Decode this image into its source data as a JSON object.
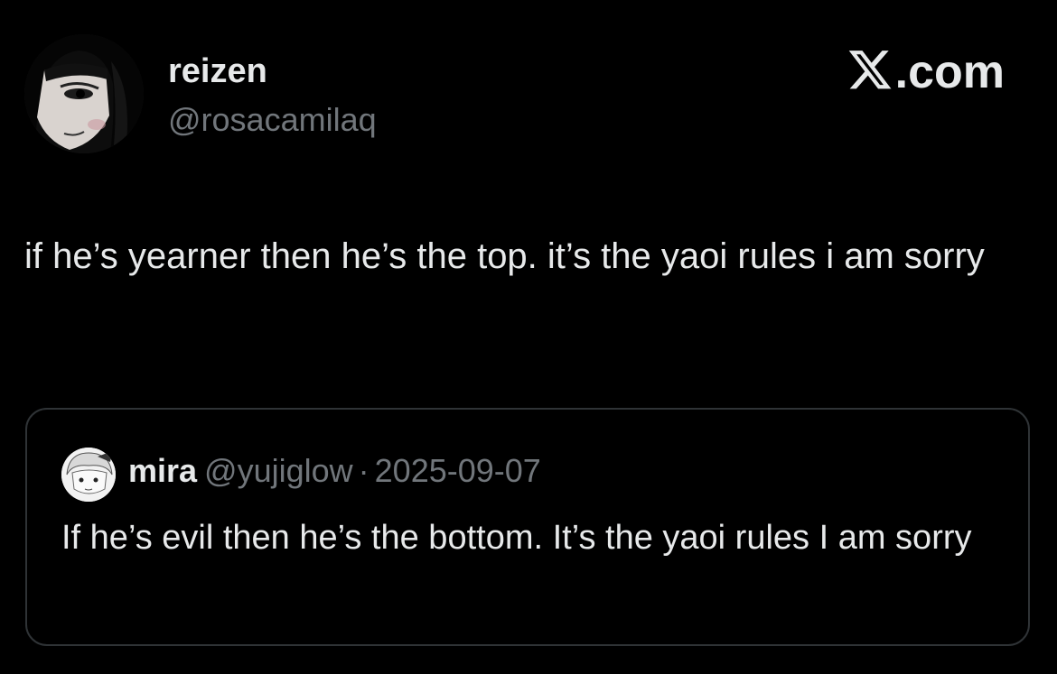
{
  "post": {
    "author": {
      "display_name": "reizen",
      "handle": "@rosacamilaq",
      "avatar": "manga-portrait-avatar"
    },
    "brand": {
      "label": ".com",
      "icon": "x-logo-icon"
    },
    "text": "if he’s yearner then he’s the top. it’s the yaoi rules i am sorry",
    "quoted": {
      "display_name": "mira",
      "handle": "@yujiglow",
      "separator": "·",
      "date": "2025-09-07",
      "text": "If he’s evil then he’s the bottom. It’s the yaoi rules I am sorry",
      "avatar": "manga-character-avatar"
    }
  },
  "colors": {
    "background": "#000000",
    "text_primary": "#e7e9ea",
    "text_secondary": "#71767b",
    "border": "#2f3336"
  }
}
